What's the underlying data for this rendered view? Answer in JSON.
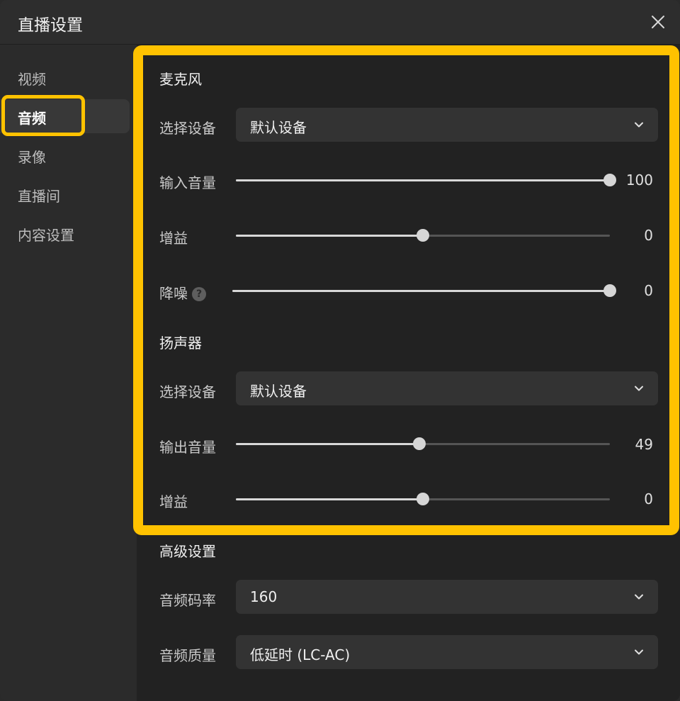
{
  "window": {
    "title": "直播设置"
  },
  "sidebar": {
    "items": [
      {
        "label": "视频",
        "active": false
      },
      {
        "label": "音频",
        "active": true
      },
      {
        "label": "录像",
        "active": false
      },
      {
        "label": "直播间",
        "active": false
      },
      {
        "label": "内容设置",
        "active": false
      }
    ]
  },
  "microphone": {
    "title": "麦克风",
    "device_label": "选择设备",
    "device_value": "默认设备",
    "input_volume_label": "输入音量",
    "input_volume_value": "100",
    "input_volume_level": 1.0,
    "gain_label": "增益",
    "gain_value": "0",
    "gain_level": 0.5,
    "noise_label": "降噪",
    "noise_help_icon": "?",
    "noise_value": "0",
    "noise_level": 1.0
  },
  "speaker": {
    "title": "扬声器",
    "device_label": "选择设备",
    "device_value": "默认设备",
    "output_volume_label": "输出音量",
    "output_volume_value": "49",
    "output_volume_level": 0.49,
    "gain_label": "增益",
    "gain_value": "0",
    "gain_level": 0.5
  },
  "advanced": {
    "title": "高级设置",
    "bitrate_label": "音频码率",
    "bitrate_value": "160",
    "quality_label": "音频质量",
    "quality_value": "低延时 (LC-AC)"
  },
  "colors": {
    "highlight": "#ffc200",
    "background": "#222222"
  },
  "icons": {
    "close": "close-icon",
    "dropdown": "chevron-down-icon",
    "help": "help-icon"
  }
}
